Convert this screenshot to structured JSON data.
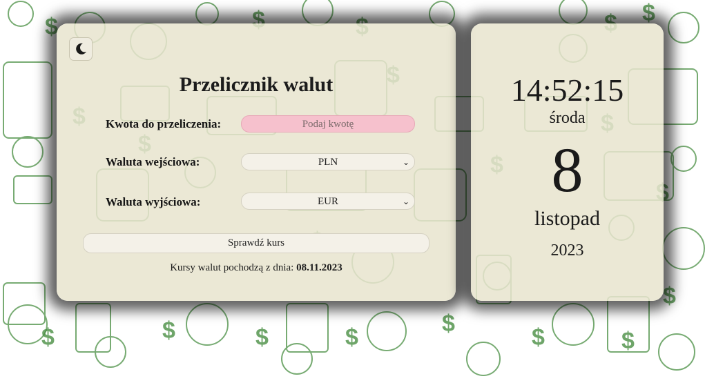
{
  "converter": {
    "title": "Przelicznik walut",
    "amount_label": "Kwota do przeliczenia:",
    "amount_placeholder": "Podaj kwotę",
    "input_currency_label": "Waluta wejściowa:",
    "input_currency_value": "PLN",
    "output_currency_label": "Waluta wyjściowa:",
    "output_currency_value": "EUR",
    "check_button": "Sprawdź kurs",
    "rates_note_prefix": "Kursy walut pochodzą z dnia:",
    "rates_date": "08.11.2023",
    "theme_toggle_icon": "moon-icon"
  },
  "clock": {
    "time": "14:52:15",
    "weekday": "środa",
    "day": "8",
    "month": "listopad",
    "year": "2023"
  },
  "colors": {
    "panel": "#e8e4ce",
    "amount_field": "#f6c1cd",
    "pattern": "#3f8a3a",
    "shadow": "#000000"
  }
}
